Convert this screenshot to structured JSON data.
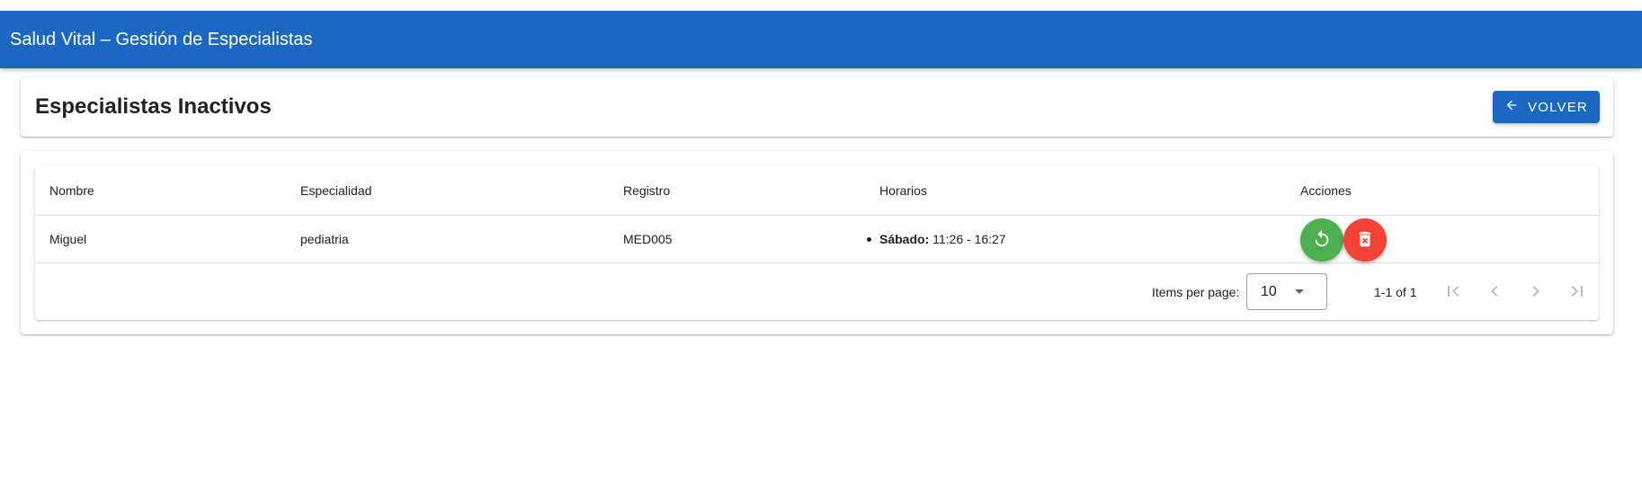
{
  "app": {
    "title": "Salud Vital – Gestión de Especialistas"
  },
  "page": {
    "title": "Especialistas Inactivos",
    "back_label": "Volver"
  },
  "table": {
    "headers": {
      "nombre": "Nombre",
      "especialidad": "Especialidad",
      "registro": "Registro",
      "horarios": "Horarios",
      "acciones": "Acciones"
    },
    "rows": [
      {
        "nombre": "Miguel",
        "especialidad": "pediatria",
        "registro": "MED005",
        "horarios": [
          {
            "dia": "Sábado:",
            "horas": " 11:26 - 16:27"
          }
        ],
        "actions": {
          "restore_icon": "restore-icon",
          "delete_icon": "delete-forever-icon"
        }
      }
    ]
  },
  "paginator": {
    "items_per_page_label": "Items per page:",
    "items_per_page_value": "10",
    "range_label": "1-1 of 1"
  },
  "colors": {
    "primary": "#1a68c2",
    "restore": "#4caf50",
    "delete": "#f44336"
  }
}
